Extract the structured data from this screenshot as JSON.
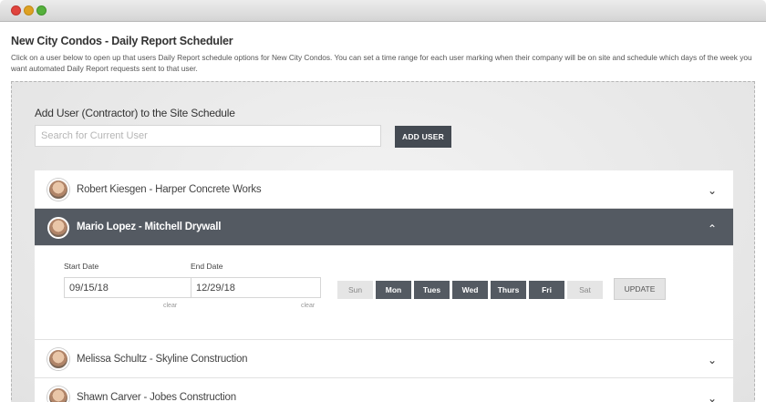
{
  "page": {
    "title": "New City Condos - Daily Report Scheduler",
    "description": "Click on a user below to open up that users Daily Report schedule options for New City Condos. You can set a time range for each user marking when their company will be on site and schedule which days of the week you want automated Daily Report requests sent to that user."
  },
  "add_user": {
    "title": "Add User (Contractor) to the Site Schedule",
    "search_placeholder": "Search for Current User",
    "button_label": "ADD USER"
  },
  "users": [
    {
      "label": "Robert Kiesgen  -  Harper Concrete Works",
      "chevron": "⌄"
    },
    {
      "label": "Mario Lopez  -  Mitchell Drywall",
      "chevron": "⌃"
    },
    {
      "label": "Melissa Schultz  -  Skyline Construction",
      "chevron": "⌄"
    },
    {
      "label": "Shawn Carver  -  Jobes Construction",
      "chevron": "⌄"
    }
  ],
  "schedule": {
    "start_label": "Start Date",
    "start_value": "09/15/18",
    "end_label": "End Date",
    "end_value": "12/29/18",
    "clear_label": "clear",
    "days": [
      {
        "label": "Sun",
        "on": false
      },
      {
        "label": "Mon",
        "on": true
      },
      {
        "label": "Tues",
        "on": true
      },
      {
        "label": "Wed",
        "on": true
      },
      {
        "label": "Thurs",
        "on": true
      },
      {
        "label": "Fri",
        "on": true
      },
      {
        "label": "Sat",
        "on": false
      }
    ],
    "update_label": "UPDATE"
  }
}
